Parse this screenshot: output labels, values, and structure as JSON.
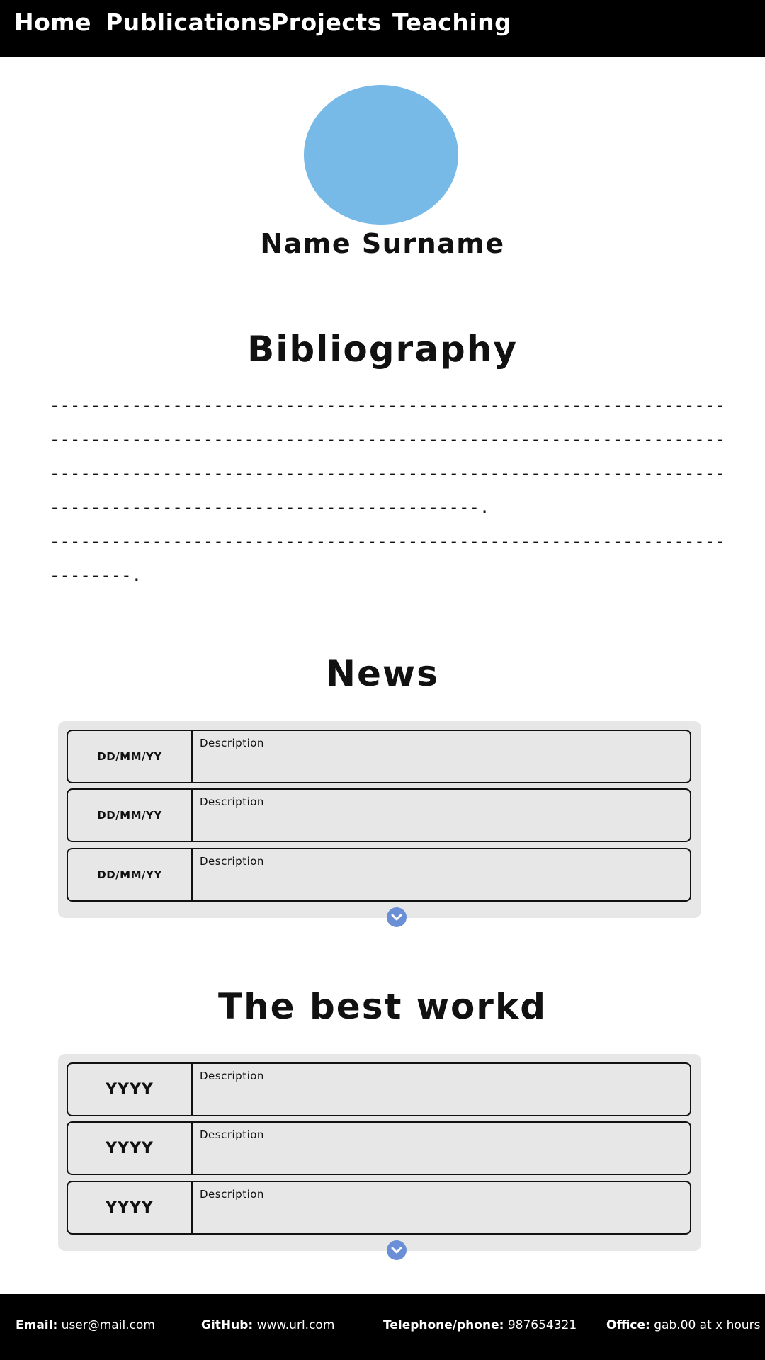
{
  "nav": {
    "items": [
      {
        "label": "Home"
      },
      {
        "label": "Publications"
      },
      {
        "label": "Projects"
      },
      {
        "label": "Teaching"
      }
    ]
  },
  "profile": {
    "name": "Name Surname"
  },
  "bibliography": {
    "title": "Bibliography",
    "lines": [
      "-----------------------------------------------------------------------",
      "-----------------------------------------------------------------------",
      "-----------------------------------------------------------------------",
      "------------------------------------------.",
      "-----------------------------------------------------------------------",
      "--------."
    ]
  },
  "news": {
    "title": "News",
    "items": [
      {
        "date": "DD/MM/YY",
        "description": "Description"
      },
      {
        "date": "DD/MM/YY",
        "description": "Description"
      },
      {
        "date": "DD/MM/YY",
        "description": "Description"
      }
    ]
  },
  "works": {
    "title": "The best workd",
    "items": [
      {
        "year": "YYYY",
        "description": "Description"
      },
      {
        "year": "YYYY",
        "description": "Description"
      },
      {
        "year": "YYYY",
        "description": "Description"
      }
    ]
  },
  "footer": {
    "email_label": "Email:",
    "email_value": "user@mail.com",
    "github_label": "GitHub:",
    "github_value": "www.url.com",
    "phone_label": "Telephone/phone:",
    "phone_value": "987654321",
    "office_label": "Office:",
    "office_value": "gab.00 at x hours"
  },
  "colors": {
    "nav_bg": "#000000",
    "avatar": "#77b9e7",
    "panel_bg": "#e7e7e7",
    "expand_icon": "#6b8fd6"
  },
  "icons": {
    "expand": "chevron-down-circle-icon"
  }
}
